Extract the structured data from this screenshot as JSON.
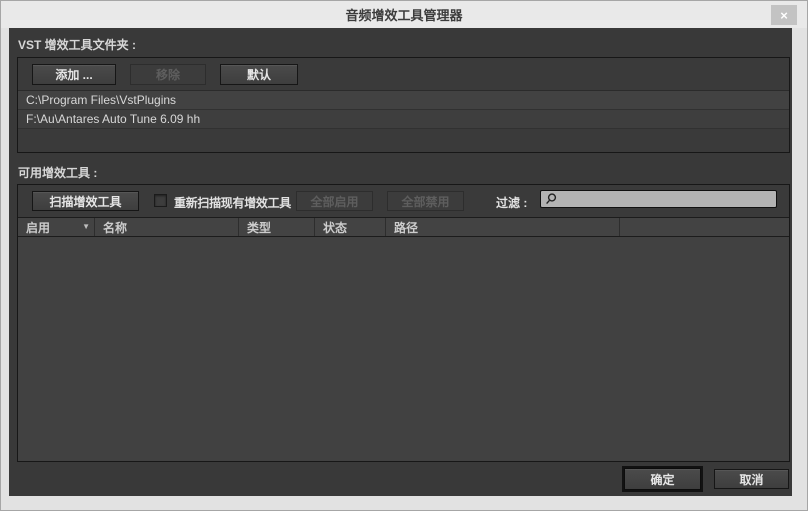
{
  "window": {
    "title": "音频增效工具管理器",
    "close_glyph": "×"
  },
  "colors": {
    "titlebar_bg": "#e9e9e9",
    "frame_bg": "#e2e2e2",
    "dialog_bg": "#393939",
    "panel_bg": "#414141",
    "button_text": "#e6e6e6",
    "disabled_text": "#5e5e5e"
  },
  "vst": {
    "label": "VST 增效工具文件夹 :",
    "add_button": "添加 ...",
    "remove_button": "移除",
    "default_button": "默认",
    "folders": [
      "C:\\Program Files\\VstPlugins",
      "F:\\Au\\Antares Auto Tune 6.09 hh"
    ]
  },
  "plugins": {
    "label": "可用增效工具 :",
    "scan_button": "扫描增效工具",
    "rescan_label": "重新扫描现有增效工具",
    "rescan_checked": false,
    "enable_all_button": "全部启用",
    "disable_all_button": "全部禁用",
    "filter_label": "过滤 :",
    "filter_value": "",
    "columns": [
      "启用",
      "名称",
      "类型",
      "状态",
      "路径"
    ],
    "rows": []
  },
  "footer": {
    "ok_button": "确定",
    "cancel_button": "取消"
  }
}
